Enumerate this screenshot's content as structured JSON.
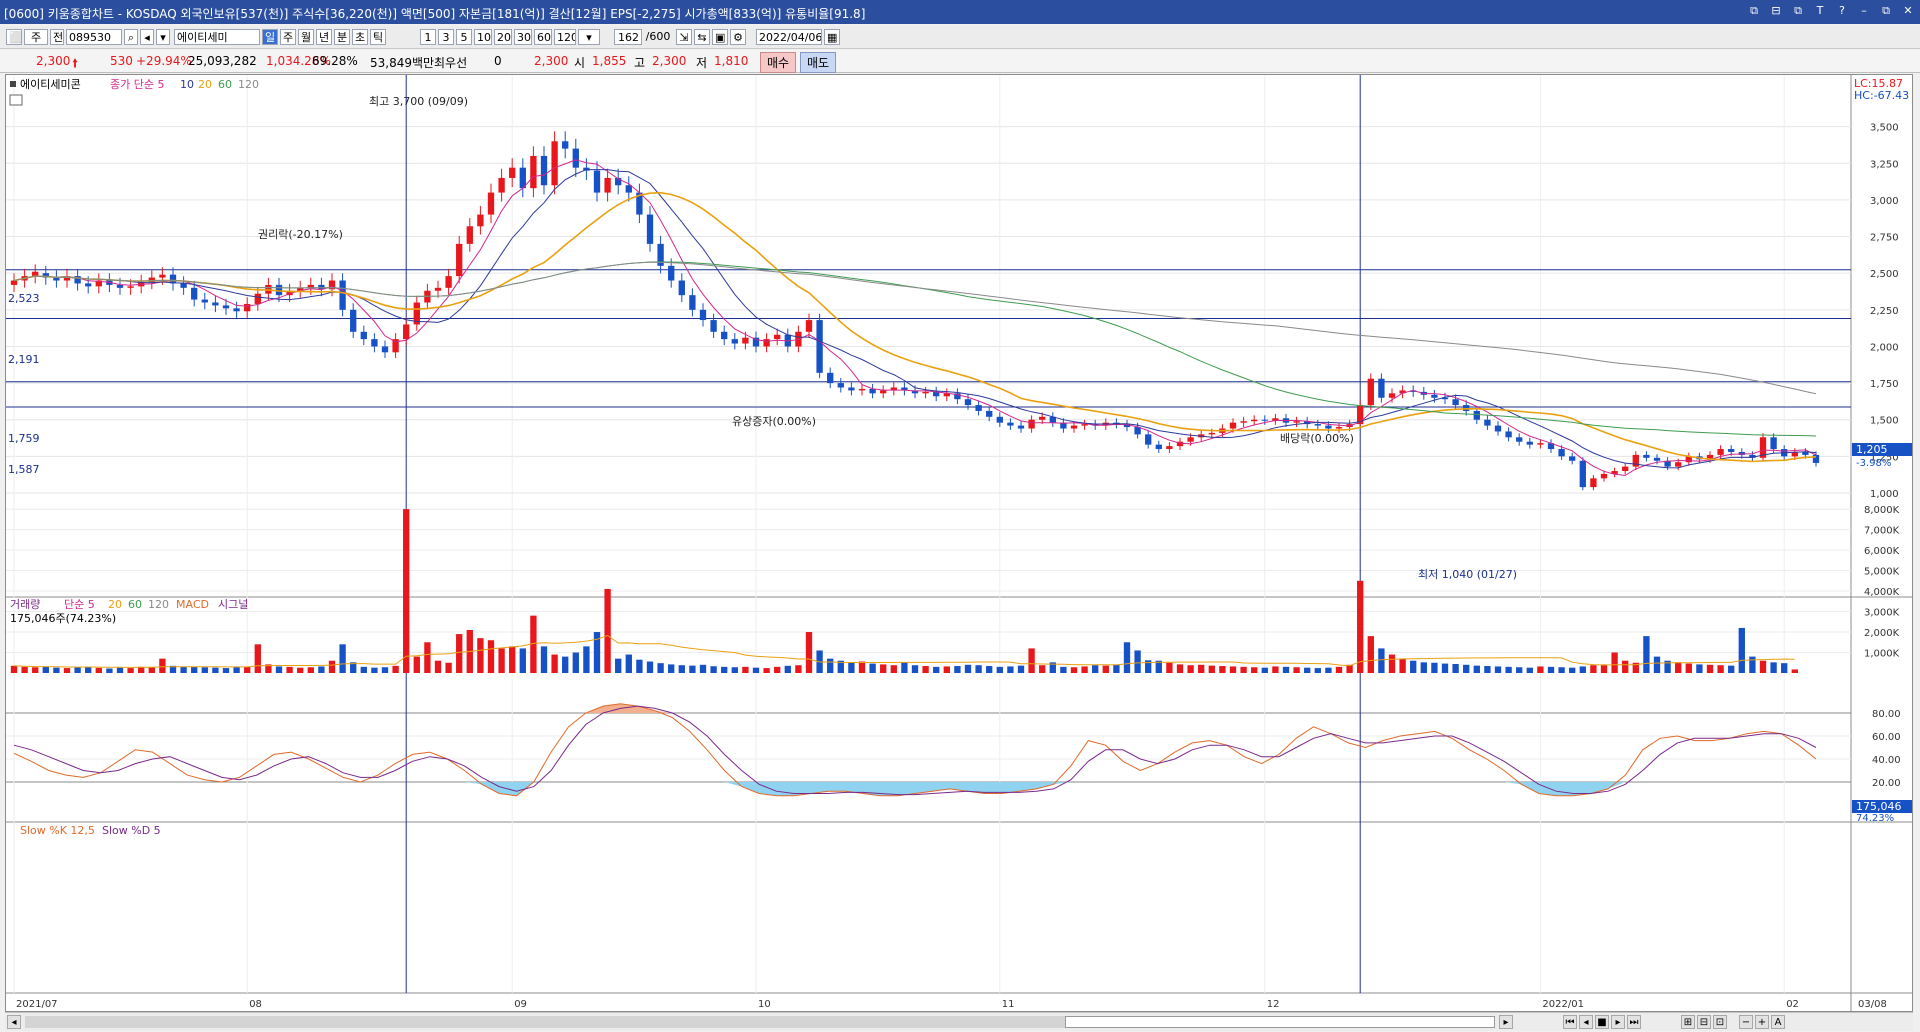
{
  "window": {
    "title": "[0600] 키움종합차트 - KOSDAQ 외국인보유[537(천)] 주식수[36,220(천)] 액면[500] 자본금[181(억)] 결산[12월] EPS[-2,275] 시가총액[833(억)] 유통비율[91.8]",
    "controls": [
      "⧉",
      "⊟",
      "⧉",
      "T",
      "?",
      "–",
      "⧉",
      "✕"
    ]
  },
  "toolbar": {
    "period_label": "주",
    "code": "089530",
    "stock_name": "에이티세미",
    "periods": [
      "일",
      "주",
      "월",
      "년",
      "분",
      "초",
      "틱"
    ],
    "multipliers": [
      "1",
      "3",
      "5",
      "10",
      "20",
      "30",
      "60",
      "120"
    ],
    "count": "162",
    "count_total": "/600",
    "date": "2022/04/06",
    "nav_labels": [
      "⬜",
      "주",
      "전"
    ]
  },
  "quote": {
    "price": "2,300",
    "change": "530",
    "change_pct": "+29.94%",
    "volume": "25,093,282",
    "volume_ratio": "1,034.28%",
    "turnover": "69.28%",
    "amount": "53,849백만",
    "priority_label": "최우선",
    "priority_qty": "0",
    "priority_price": "2,300",
    "open_label": "시",
    "open": "1,855",
    "high_label": "고",
    "high": "2,300",
    "low_label": "저",
    "low": "1,810",
    "buy_label": "매수",
    "sell_label": "매도"
  },
  "colors": {
    "up": "#e8171b",
    "down": "#1651c6",
    "ma5": "#d4268f",
    "ma10": "#2d3a9b",
    "ma20": "#e9a10f",
    "ma60": "#3f9c4f",
    "ma120": "#8a8a8a",
    "hline": "#1c2f8f",
    "stoch_fill": "#8fd3f0",
    "overbought_fill": "#f2b090"
  },
  "price_panel": {
    "legend_name": "에이티세미콘",
    "legend": [
      "종가 단순 5",
      "10",
      "20",
      "60",
      "120"
    ],
    "hc_lc": [
      "LC:15.87",
      "HC:-67.43"
    ],
    "last_price": "1,205",
    "last_change": "-3.98%",
    "annotations": {
      "high": "최고 3,700 (09/09)",
      "low": "최저 1,040 (01/27)",
      "rights": "권리락(-20.17%)",
      "capital_increase": "유상증자(0.00%)",
      "dividend": "배당락(0.00%)"
    },
    "levels": [
      "2,523",
      "2,191",
      "1,759",
      "1,587"
    ]
  },
  "volume_panel": {
    "legend": [
      "거래량",
      "단순 5",
      "20",
      "60",
      "120",
      "MACD",
      "시그널"
    ],
    "last_volume": "175,046주(74.23%)",
    "last_tag": "175,046",
    "last_pct": "74.23%"
  },
  "stoch_panel": {
    "legend": [
      "Slow %K 12,5",
      "Slow %D 5"
    ]
  },
  "x_axis_labels": [
    "2021/07",
    "08",
    "09",
    "10",
    "11",
    "12",
    "2022/01",
    "02",
    "03",
    "03/08"
  ],
  "chart_data": [
    {
      "type": "candlestick",
      "name": "에이티세미콘 일봉",
      "x_start": "2021/07",
      "x_end": "03/08",
      "ylim": [
        1000,
        3750
      ],
      "y_ticks": [
        1000,
        1250,
        1500,
        1750,
        2000,
        2250,
        2500,
        2750,
        3000,
        3250,
        3500
      ],
      "close": [
        2450,
        2480,
        2510,
        2470,
        2450,
        2480,
        2430,
        2410,
        2450,
        2420,
        2400,
        2410,
        2440,
        2470,
        2490,
        2430,
        2400,
        2320,
        2300,
        2280,
        2260,
        2240,
        2290,
        2360,
        2420,
        2350,
        2380,
        2400,
        2420,
        2390,
        2450,
        2250,
        2100,
        2050,
        2000,
        1960,
        2050,
        2150,
        2300,
        2380,
        2400,
        2480,
        2700,
        2820,
        2900,
        3050,
        3150,
        3220,
        3080,
        3300,
        3100,
        3400,
        3350,
        3220,
        3200,
        3050,
        3150,
        3100,
        3050,
        2900,
        2700,
        2550,
        2450,
        2350,
        2250,
        2180,
        2100,
        2050,
        2020,
        2060,
        2000,
        2050,
        2080,
        2000,
        2100,
        2180,
        1820,
        1750,
        1720,
        1700,
        1710,
        1680,
        1700,
        1720,
        1700,
        1680,
        1690,
        1660,
        1680,
        1640,
        1600,
        1560,
        1520,
        1480,
        1460,
        1440,
        1500,
        1520,
        1480,
        1440,
        1460,
        1470,
        1460,
        1480,
        1470,
        1450,
        1400,
        1330,
        1300,
        1320,
        1350,
        1380,
        1400,
        1410,
        1440,
        1480,
        1490,
        1500,
        1495,
        1510,
        1480,
        1490,
        1470,
        1460,
        1440,
        1450,
        1470,
        1600,
        1780,
        1650,
        1680,
        1700,
        1690,
        1670,
        1650,
        1640,
        1600,
        1560,
        1500,
        1460,
        1420,
        1380,
        1350,
        1330,
        1340,
        1300,
        1250,
        1220,
        1040,
        1100,
        1130,
        1150,
        1180,
        1260,
        1240,
        1220,
        1180,
        1210,
        1250,
        1230,
        1260,
        1300,
        1280,
        1260,
        1240,
        1380,
        1300,
        1250,
        1280,
        1260,
        1205
      ],
      "open": [
        2420,
        2450,
        2480,
        2500,
        2470,
        2450,
        2480,
        2430,
        2410,
        2450,
        2420,
        2400,
        2410,
        2440,
        2470,
        2490,
        2430,
        2400,
        2320,
        2300,
        2280,
        2260,
        2240,
        2290,
        2360,
        2420,
        2350,
        2380,
        2400,
        2420,
        2390,
        2450,
        2250,
        2100,
        2050,
        2000,
        1960,
        2050,
        2150,
        2300,
        2380,
        2400,
        2480,
        2700,
        2820,
        2900,
        3050,
        3150,
        3220,
        3080,
        3300,
        3100,
        3400,
        3350,
        3220,
        3200,
        3050,
        3150,
        3100,
        3050,
        2900,
        2700,
        2550,
        2450,
        2350,
        2250,
        2180,
        2100,
        2050,
        2020,
        2060,
        2000,
        2050,
        2080,
        2000,
        2100,
        2180,
        1820,
        1750,
        1720,
        1700,
        1710,
        1680,
        1700,
        1720,
        1700,
        1680,
        1690,
        1660,
        1680,
        1640,
        1600,
        1560,
        1520,
        1480,
        1460,
        1440,
        1500,
        1520,
        1480,
        1440,
        1460,
        1470,
        1460,
        1480,
        1470,
        1450,
        1400,
        1330,
        1300,
        1320,
        1350,
        1380,
        1400,
        1410,
        1440,
        1480,
        1490,
        1500,
        1495,
        1510,
        1480,
        1490,
        1470,
        1460,
        1440,
        1450,
        1470,
        1600,
        1780,
        1650,
        1680,
        1700,
        1690,
        1670,
        1650,
        1640,
        1600,
        1560,
        1500,
        1460,
        1420,
        1380,
        1350,
        1330,
        1340,
        1300,
        1250,
        1220,
        1040,
        1100,
        1130,
        1150,
        1180,
        1260,
        1240,
        1220,
        1180,
        1210,
        1250,
        1230,
        1260,
        1300,
        1280,
        1260,
        1240,
        1380,
        1300,
        1250,
        1280,
        1260
      ],
      "volume_k": [
        350,
        300,
        280,
        320,
        260,
        240,
        280,
        300,
        250,
        220,
        260,
        240,
        300,
        280,
        700,
        350,
        320,
        300,
        280,
        260,
        240,
        280,
        300,
        1400,
        420,
        320,
        300,
        260,
        280,
        320,
        600,
        1400,
        520,
        300,
        260,
        280,
        350,
        8000,
        800,
        1500,
        600,
        500,
        1900,
        2100,
        1700,
        1600,
        1200,
        1300,
        1200,
        2800,
        1300,
        900,
        800,
        1000,
        1300,
        2000,
        4100,
        700,
        900,
        650,
        560,
        480,
        420,
        380,
        360,
        400,
        330,
        300,
        280,
        300,
        260,
        240,
        300,
        350,
        380,
        2000,
        1100,
        700,
        600,
        500,
        560,
        460,
        420,
        380,
        520,
        380,
        340,
        300,
        320,
        340,
        400,
        380,
        340,
        300,
        320,
        360,
        1200,
        380,
        520,
        300,
        280,
        320,
        380,
        360,
        420,
        1500,
        1100,
        620,
        600,
        500,
        420,
        380,
        400,
        360,
        340,
        320,
        300,
        280,
        260,
        320,
        300,
        280,
        260,
        240,
        260,
        300,
        400,
        4500,
        1800,
        1200,
        900,
        700,
        600,
        520,
        500,
        460,
        440,
        400,
        360,
        340,
        320,
        300,
        280,
        260,
        320,
        300,
        280,
        260,
        320,
        380,
        420,
        1000,
        600,
        500,
        1800,
        800,
        600,
        520,
        460,
        420,
        400,
        380,
        360,
        2200,
        800,
        600,
        520,
        480,
        175
      ]
    },
    {
      "type": "line",
      "name": "Slow %K 12,5 / Slow %D 5",
      "ylim": [
        0,
        100
      ],
      "y_ticks": [
        20,
        40,
        60,
        80
      ],
      "k": [
        45,
        38,
        30,
        26,
        24,
        28,
        38,
        48,
        46,
        36,
        26,
        22,
        20,
        24,
        34,
        44,
        46,
        40,
        32,
        24,
        20,
        26,
        36,
        44,
        46,
        40,
        30,
        18,
        10,
        8,
        20,
        46,
        68,
        80,
        86,
        88,
        86,
        82,
        76,
        64,
        48,
        30,
        16,
        10,
        8,
        8,
        10,
        12,
        12,
        10,
        8,
        8,
        10,
        12,
        14,
        12,
        10,
        10,
        12,
        14,
        18,
        34,
        56,
        52,
        38,
        30,
        36,
        46,
        54,
        56,
        52,
        42,
        36,
        44,
        58,
        68,
        62,
        54,
        50,
        56,
        60,
        62,
        64,
        58,
        48,
        40,
        30,
        18,
        10,
        8,
        8,
        10,
        14,
        26,
        48,
        58,
        60,
        56,
        56,
        58,
        62,
        64,
        62,
        52,
        40
      ],
      "d": [
        52,
        48,
        42,
        36,
        30,
        28,
        30,
        36,
        40,
        42,
        36,
        30,
        24,
        22,
        26,
        34,
        40,
        42,
        36,
        28,
        24,
        24,
        30,
        38,
        42,
        40,
        34,
        24,
        16,
        12,
        16,
        30,
        52,
        70,
        80,
        84,
        86,
        84,
        80,
        72,
        60,
        44,
        30,
        18,
        12,
        10,
        10,
        10,
        11,
        11,
        10,
        9,
        9,
        10,
        11,
        12,
        11,
        11,
        11,
        12,
        14,
        22,
        38,
        48,
        48,
        40,
        36,
        40,
        48,
        52,
        52,
        48,
        42,
        42,
        50,
        58,
        62,
        58,
        54,
        54,
        56,
        58,
        60,
        60,
        54,
        46,
        38,
        28,
        18,
        12,
        10,
        10,
        12,
        18,
        30,
        44,
        54,
        58,
        58,
        58,
        60,
        62,
        62,
        58,
        50
      ]
    }
  ]
}
